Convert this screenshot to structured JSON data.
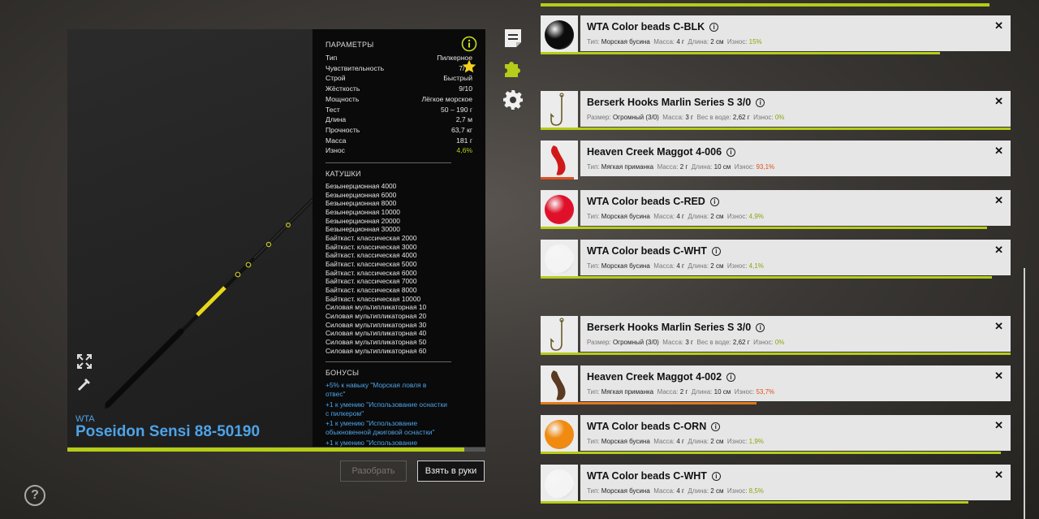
{
  "rod": {
    "brand": "WTA",
    "name": "Poseidon Sensi 88-50190",
    "progress_pct": 95
  },
  "params": {
    "title": "ПАРАМЕТРЫ",
    "rows": [
      {
        "label": "Тип",
        "value": "Пилкерное"
      },
      {
        "label": "Чувствительность",
        "value": "7/10"
      },
      {
        "label": "Строй",
        "value": "Быстрый"
      },
      {
        "label": "Жёсткость",
        "value": "9/10"
      },
      {
        "label": "Мощность",
        "value": "Лёгкое морское"
      },
      {
        "label": "Тест",
        "value": "50 – 190 г"
      },
      {
        "label": "Длина",
        "value": "2,7 м"
      },
      {
        "label": "Прочность",
        "value": "63,7 кг"
      },
      {
        "label": "Масса",
        "value": "181 г"
      },
      {
        "label": "Износ",
        "value": "4,6%"
      }
    ],
    "reels_title": "КАТУШКИ",
    "reels": [
      "Безынерционная 4000",
      "Безынерционная 6000",
      "Безынерционная 8000",
      "Безынерционная 10000",
      "Безынерционная 20000",
      "Безынерционная 30000",
      "Байткаст. классическая 2000",
      "Байткаст. классическая 3000",
      "Байткаст. классическая 4000",
      "Байткаст. классическая 5000",
      "Байткаст. классическая 6000",
      "Байткаст. классическая 7000",
      "Байткаст. классическая 8000",
      "Байткаст. классическая 10000",
      "Силовая мультипликаторная 10",
      "Силовая мультипликаторная 20",
      "Силовая мультипликаторная 30",
      "Силовая мультипликаторная 40",
      "Силовая мультипликаторная 50",
      "Силовая мультипликаторная 60"
    ],
    "bonus_title": "БОНУСЫ",
    "bonuses": [
      "+5% к навыку \"Морская ловля в отвес\"",
      "+1 к умению \"Использование оснастки с пилкером\"",
      "+1 к умению \"Использование обыкновенной джиговой оснастки\"",
      "+1 к умению \"Использование"
    ]
  },
  "buttons": {
    "disassemble": "Разобрать",
    "take": "Взять в руки"
  },
  "colors": {
    "accent": "#b5cc18",
    "blue": "#4da3e8",
    "danger": "#e05020",
    "warn": "#e07a20"
  },
  "labels": {
    "type": "Тип:",
    "size": "Размер:",
    "mass": "Масса:",
    "length": "Длина:",
    "water_weight": "Вес в воде:",
    "wear": "Износ:"
  },
  "items": [
    {
      "name": "WTA Color beads C-BLK",
      "kind": "bead",
      "color": "#0c0c0c",
      "a_label": "Тип:",
      "a_value": "Морская бусина",
      "mass": "4 г",
      "c_label": "Длина:",
      "c_value": "2 см",
      "wear": "15%",
      "wear_pct": 85,
      "wear_state": "ok"
    },
    {
      "name": "Berserk Hooks Marlin Series S 3/0",
      "kind": "hook",
      "a_label": "Размер:",
      "a_value": "Огромный (3/0)",
      "mass": "3 г",
      "c_label": "Вес в воде:",
      "c_value": "2,62 г",
      "wear": "0%",
      "wear_pct": 100,
      "wear_state": "ok"
    },
    {
      "name": "Heaven Creek Maggot 4-006",
      "kind": "worm-red",
      "a_label": "Тип:",
      "a_value": "Мягкая приманка",
      "mass": "2 г",
      "c_label": "Длина:",
      "c_value": "10 см",
      "wear": "93,1%",
      "wear_pct": 7,
      "wear_state": "bad"
    },
    {
      "name": "WTA Color beads C-RED",
      "kind": "bead",
      "color": "#e0102a",
      "a_label": "Тип:",
      "a_value": "Морская бусина",
      "mass": "4 г",
      "c_label": "Длина:",
      "c_value": "2 см",
      "wear": "4,9%",
      "wear_pct": 95,
      "wear_state": "ok"
    },
    {
      "name": "WTA Color beads C-WHT",
      "kind": "bead",
      "color": "#f4f4f4",
      "a_label": "Тип:",
      "a_value": "Морская бусина",
      "mass": "4 г",
      "c_label": "Длина:",
      "c_value": "2 см",
      "wear": "4,1%",
      "wear_pct": 96,
      "wear_state": "ok"
    },
    {
      "name": "Berserk Hooks Marlin Series S 3/0",
      "kind": "hook",
      "a_label": "Размер:",
      "a_value": "Огромный (3/0)",
      "mass": "3 г",
      "c_label": "Вес в воде:",
      "c_value": "2,62 г",
      "wear": "0%",
      "wear_pct": 100,
      "wear_state": "ok"
    },
    {
      "name": "Heaven Creek Maggot 4-002",
      "kind": "worm-brown",
      "a_label": "Тип:",
      "a_value": "Мягкая приманка",
      "mass": "2 г",
      "c_label": "Длина:",
      "c_value": "10 см",
      "wear": "53,7%",
      "wear_pct": 46,
      "wear_state": "warn"
    },
    {
      "name": "WTA Color beads C-ORN",
      "kind": "bead",
      "color": "#f08a10",
      "a_label": "Тип:",
      "a_value": "Морская бусина",
      "mass": "4 г",
      "c_label": "Длина:",
      "c_value": "2 см",
      "wear": "1,9%",
      "wear_pct": 98,
      "wear_state": "ok"
    },
    {
      "name": "WTA Color beads C-WHT",
      "kind": "bead",
      "color": "#f4f4f4",
      "a_label": "Тип:",
      "a_value": "Морская бусина",
      "mass": "4 г",
      "c_label": "Длина:",
      "c_value": "2 см",
      "wear": "8,5%",
      "wear_pct": 91,
      "wear_state": "ok"
    }
  ]
}
